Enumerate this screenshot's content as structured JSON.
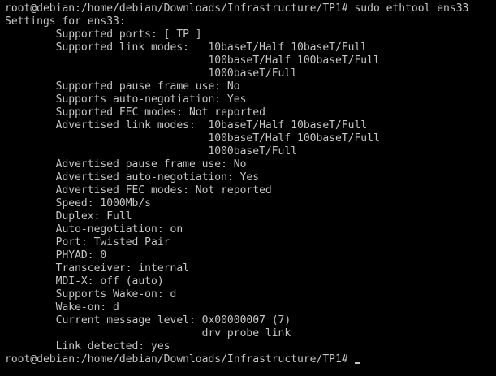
{
  "colors": {
    "background": "#000000",
    "foreground": "#c6c6c6"
  },
  "terminal": {
    "lines": [
      "root@debian:/home/debian/Downloads/Infrastructure/TP1# sudo ethtool ens33",
      "Settings for ens33:",
      "        Supported ports: [ TP ]",
      "        Supported link modes:   10baseT/Half 10baseT/Full",
      "                                100baseT/Half 100baseT/Full",
      "                                1000baseT/Full",
      "        Supported pause frame use: No",
      "        Supports auto-negotiation: Yes",
      "        Supported FEC modes: Not reported",
      "        Advertised link modes:  10baseT/Half 10baseT/Full",
      "                                100baseT/Half 100baseT/Full",
      "                                1000baseT/Full",
      "        Advertised pause frame use: No",
      "        Advertised auto-negotiation: Yes",
      "        Advertised FEC modes: Not reported",
      "        Speed: 1000Mb/s",
      "        Duplex: Full",
      "        Auto-negotiation: on",
      "        Port: Twisted Pair",
      "        PHYAD: 0",
      "        Transceiver: internal",
      "        MDI-X: off (auto)",
      "        Supports Wake-on: d",
      "        Wake-on: d",
      "        Current message level: 0x00000007 (7)",
      "                               drv probe link",
      "        Link detected: yes"
    ],
    "prompt": "root@debian:/home/debian/Downloads/Infrastructure/TP1# "
  }
}
